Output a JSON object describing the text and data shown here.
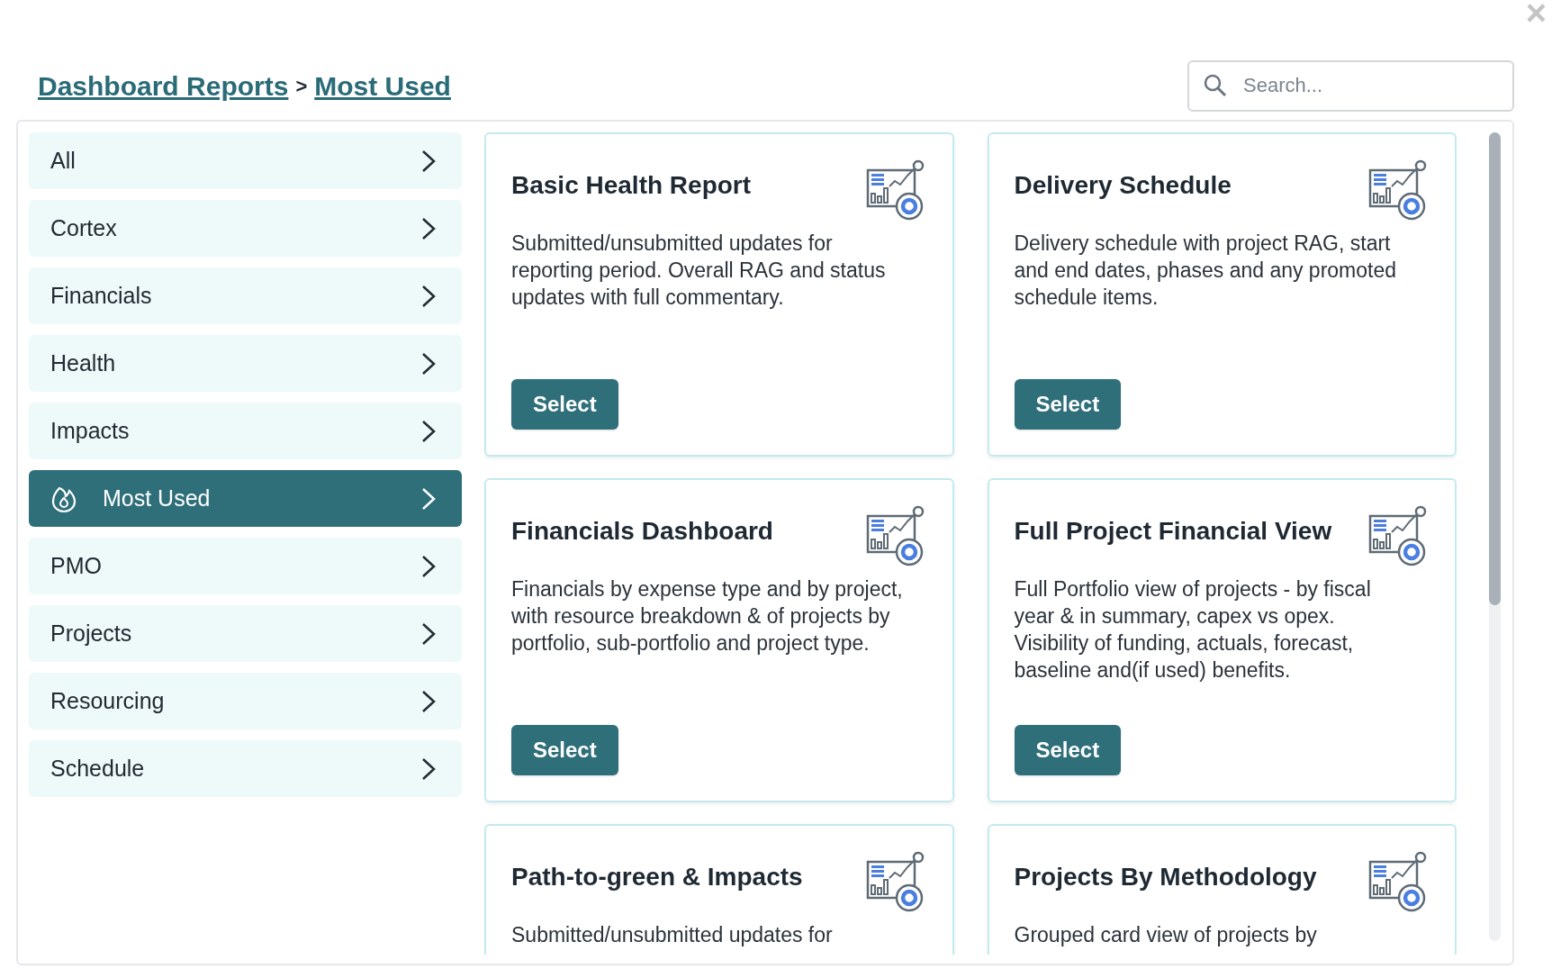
{
  "close_label": "×",
  "breadcrumb": {
    "links": [
      "Dashboard Reports",
      "Most Used"
    ],
    "separator": ">"
  },
  "search": {
    "placeholder": "Search..."
  },
  "sidebar": {
    "items": [
      {
        "label": "All",
        "selected": false
      },
      {
        "label": "Cortex",
        "selected": false
      },
      {
        "label": "Financials",
        "selected": false
      },
      {
        "label": "Health",
        "selected": false
      },
      {
        "label": "Impacts",
        "selected": false
      },
      {
        "label": "Most Used",
        "selected": true
      },
      {
        "label": "PMO",
        "selected": false
      },
      {
        "label": "Projects",
        "selected": false
      },
      {
        "label": "Resourcing",
        "selected": false
      },
      {
        "label": "Schedule",
        "selected": false
      }
    ]
  },
  "cards": [
    {
      "title": "Basic Health Report",
      "description": "Submitted/unsubmitted updates for reporting period. Overall RAG and status updates with full commentary.",
      "button": "Select"
    },
    {
      "title": "Delivery Schedule",
      "description": "Delivery schedule with project RAG, start and end dates, phases and any promoted schedule items.",
      "button": "Select"
    },
    {
      "title": "Financials Dashboard",
      "description": "Financials by expense type and by project, with resource breakdown & of projects by portfolio, sub-portfolio and project type.",
      "button": "Select"
    },
    {
      "title": "Full Project Financial View",
      "description": "Full Portfolio view of projects - by fiscal year & in summary, capex vs opex. Visibility of funding, actuals, forecast, baseline and(if used) benefits.",
      "button": "Select"
    },
    {
      "title": "Path-to-green & Impacts",
      "description": "Submitted/unsubmitted updates for"
    },
    {
      "title": "Projects By Methodology",
      "description": "Grouped card view of projects by"
    }
  ]
}
